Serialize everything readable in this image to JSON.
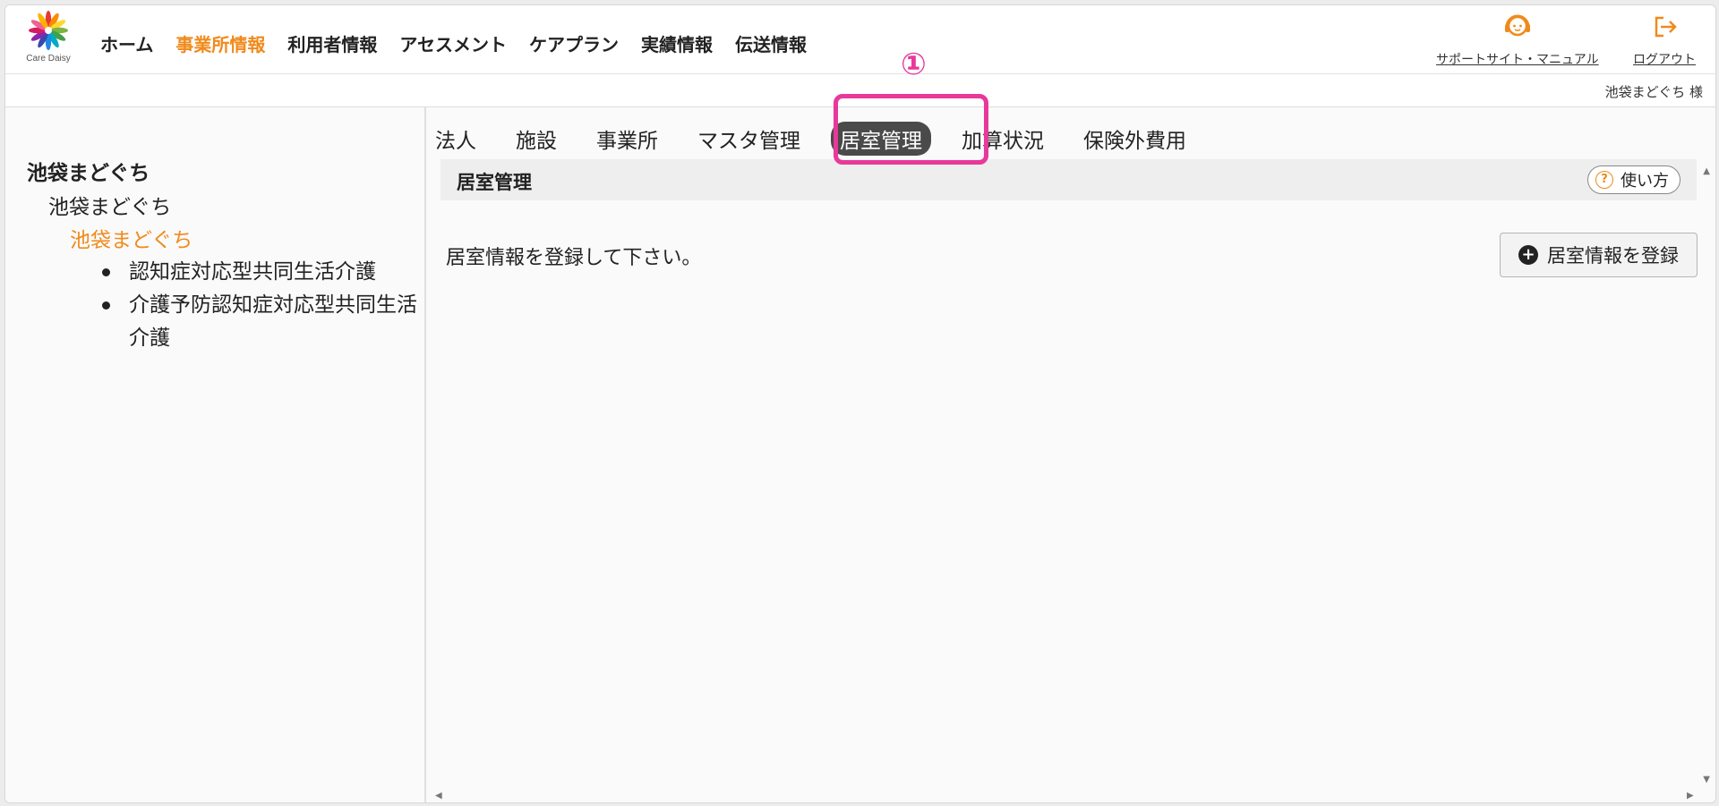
{
  "brand": {
    "logo_text": "Care Daisy",
    "petal_colors": [
      "#e53935",
      "#fb8c00",
      "#fdd835",
      "#7cb342",
      "#43a047",
      "#00acc1",
      "#1e88e5",
      "#3949ab",
      "#8e24aa",
      "#d81b60",
      "#f06292",
      "#ffb300"
    ],
    "accent": "#f08a1c",
    "annotation_color": "#e8389a"
  },
  "main_nav": [
    {
      "label": "ホーム",
      "active": false
    },
    {
      "label": "事業所情報",
      "active": true
    },
    {
      "label": "利用者情報",
      "active": false
    },
    {
      "label": "アセスメント",
      "active": false
    },
    {
      "label": "ケアプラン",
      "active": false
    },
    {
      "label": "実績情報",
      "active": false
    },
    {
      "label": "伝送情報",
      "active": false
    }
  ],
  "header_links": {
    "support": {
      "label": "サポートサイト・マニュアル",
      "icon": "headset-icon"
    },
    "logout": {
      "label": "ログアウト",
      "icon": "logout-icon"
    }
  },
  "user": {
    "display_name": "池袋まどぐち 様"
  },
  "sidebar": {
    "corporation": "池袋まどぐち",
    "facility": "池袋まどぐち",
    "office": "池袋まどぐち",
    "services": [
      "認知症対応型共同生活介護",
      "介護予防認知症対応型共同生活介護"
    ]
  },
  "sub_tabs": [
    {
      "label": "法人",
      "active": false
    },
    {
      "label": "施設",
      "active": false
    },
    {
      "label": "事業所",
      "active": false
    },
    {
      "label": "マスタ管理",
      "active": false
    },
    {
      "label": "居室管理",
      "active": true
    },
    {
      "label": "加算状況",
      "active": false
    },
    {
      "label": "保険外費用",
      "active": false
    }
  ],
  "panel": {
    "title": "居室管理",
    "help_label": "使い方",
    "help_icon_glyph": "?",
    "message": "居室情報を登録して下さい。",
    "register_label": "居室情報を登録",
    "register_icon_glyph": "+"
  },
  "annotation": {
    "marker": "①"
  }
}
